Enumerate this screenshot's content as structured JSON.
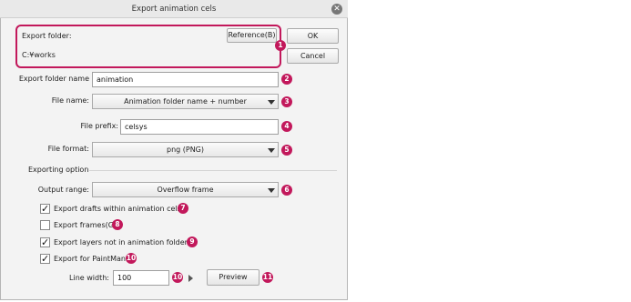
{
  "window": {
    "title": "Export animation cels",
    "close_icon": "close-circle-icon"
  },
  "header": {
    "export_folder_label": "Export folder:",
    "reference_button": "Reference(B)",
    "path": "C:¥works",
    "ok_button": "OK",
    "cancel_button": "Cancel"
  },
  "form": {
    "export_folder_name_label": "Export folder name",
    "export_folder_name_value": "animation",
    "file_name_label": "File name:",
    "file_name_value": "Animation folder name + number",
    "file_prefix_label": "File prefix:",
    "file_prefix_value": "celsys",
    "file_format_label": "File format:",
    "file_format_value": "png (PNG)"
  },
  "exporting_option": {
    "section_label": "Exporting option",
    "output_range_label": "Output range:",
    "output_range_value": "Overflow frame",
    "checkboxes": [
      {
        "label": "Export drafts within animation cels",
        "checked": true
      },
      {
        "label": "Export frames(G)",
        "checked": false
      },
      {
        "label": "Export layers not in animation folders",
        "checked": true
      },
      {
        "label": "Export for PaintMan",
        "checked": true
      }
    ],
    "line_width_label": "Line width:",
    "line_width_value": "100",
    "preview_button": "Preview"
  },
  "callouts": [
    "1",
    "2",
    "3",
    "4",
    "5",
    "6",
    "7",
    "8",
    "9",
    "10",
    "10",
    "11"
  ],
  "colors": {
    "callout": "#c2185b",
    "highlight_border": "#c2185b"
  }
}
